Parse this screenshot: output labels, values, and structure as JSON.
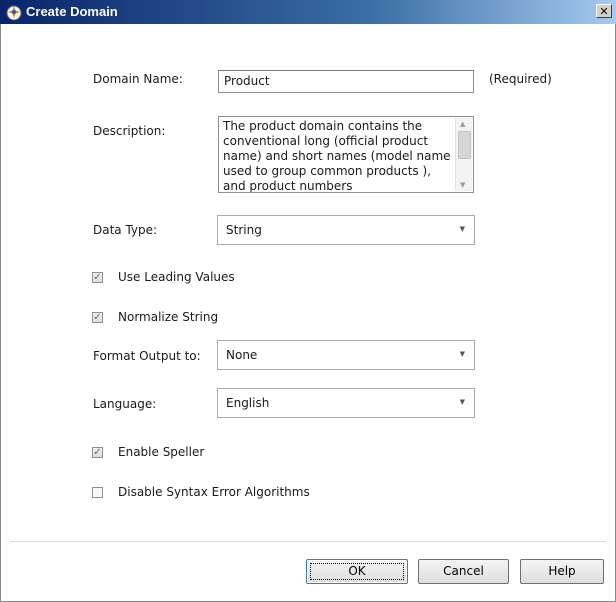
{
  "window": {
    "title": "Create Domain",
    "close_glyph": "✕"
  },
  "form": {
    "domain_name_label": "Domain Name:",
    "domain_name_value": "Product",
    "required_text": "(Required)",
    "description_label": "Description:",
    "description_value": "The product domain contains the conventional long (official product name) and short names (model name used to group common products ), and product numbers",
    "data_type_label": "Data Type:",
    "data_type_value": "String",
    "use_leading_values_label": "Use Leading Values",
    "use_leading_values_checked": true,
    "normalize_string_label": "Normalize String",
    "normalize_string_checked": true,
    "format_output_label": "Format Output to:",
    "format_output_value": "None",
    "language_label": "Language:",
    "language_value": "English",
    "enable_speller_label": "Enable Speller",
    "enable_speller_checked": true,
    "disable_syntax_label": "Disable Syntax Error Algorithms",
    "disable_syntax_checked": false
  },
  "buttons": {
    "ok": "OK",
    "cancel": "Cancel",
    "help": "Help"
  },
  "icons": {
    "app": "domain-app-icon",
    "close": "close-icon",
    "dropdown": "chevron-down-icon",
    "check": "checkmark-icon"
  }
}
